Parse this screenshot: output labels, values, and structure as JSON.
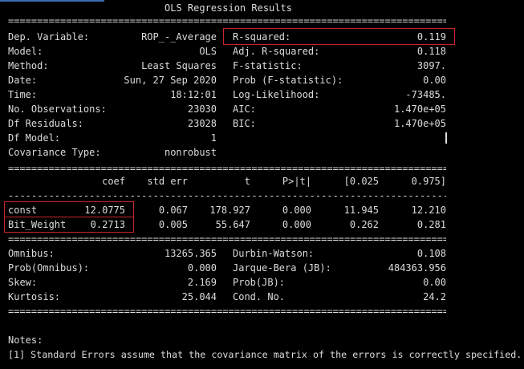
{
  "title": "OLS Regression Results",
  "separators": {
    "double": "==============================================================================",
    "single": "------------------------------------------------------------------------------"
  },
  "summary": {
    "left": [
      {
        "label": "Dep. Variable:",
        "value": "ROP_-_Average"
      },
      {
        "label": "Model:",
        "value": "OLS"
      },
      {
        "label": "Method:",
        "value": "Least Squares"
      },
      {
        "label": "Date:",
        "value": "Sun, 27 Sep 2020"
      },
      {
        "label": "Time:",
        "value": "18:12:01"
      },
      {
        "label": "No. Observations:",
        "value": "23030"
      },
      {
        "label": "Df Residuals:",
        "value": "23028"
      },
      {
        "label": "Df Model:",
        "value": "1"
      },
      {
        "label": "Covariance Type:",
        "value": "nonrobust"
      }
    ],
    "right": [
      {
        "label": "R-squared:",
        "value": "0.119"
      },
      {
        "label": "Adj. R-squared:",
        "value": "0.118"
      },
      {
        "label": "F-statistic:",
        "value": "3097."
      },
      {
        "label": "Prob (F-statistic):",
        "value": "0.00"
      },
      {
        "label": "Log-Likelihood:",
        "value": "-73485."
      },
      {
        "label": "AIC:",
        "value": "1.470e+05"
      },
      {
        "label": "BIC:",
        "value": "1.470e+05"
      }
    ]
  },
  "coef_table": {
    "headers": [
      "coef",
      "std err",
      "t",
      "P>|t|",
      "[0.025",
      "0.975]"
    ],
    "rows": [
      {
        "name": "const",
        "coef": "12.0775",
        "std_err": "0.067",
        "t": "178.927",
        "p": "0.000",
        "lo": "11.945",
        "hi": "12.210"
      },
      {
        "name": "Bit_Weight",
        "coef": "0.2713",
        "std_err": "0.005",
        "t": "55.647",
        "p": "0.000",
        "lo": "0.262",
        "hi": "0.281"
      }
    ]
  },
  "diagnostics": {
    "left": [
      {
        "label": "Omnibus:",
        "value": "13265.365"
      },
      {
        "label": "Prob(Omnibus):",
        "value": "0.000"
      },
      {
        "label": "Skew:",
        "value": "2.169"
      },
      {
        "label": "Kurtosis:",
        "value": "25.044"
      }
    ],
    "right": [
      {
        "label": "Durbin-Watson:",
        "value": "0.108"
      },
      {
        "label": "Jarque-Bera (JB):",
        "value": "484363.956"
      },
      {
        "label": "Prob(JB):",
        "value": "0.00"
      },
      {
        "label": "Cond. No.",
        "value": "24.2"
      }
    ]
  },
  "notes": {
    "heading": "Notes:",
    "items": [
      "[1] Standard Errors assume that the covariance matrix of the errors is correctly specified."
    ]
  },
  "colors": {
    "background": "#000000",
    "text": "#dcdcdc",
    "highlight": "#c8262a"
  }
}
